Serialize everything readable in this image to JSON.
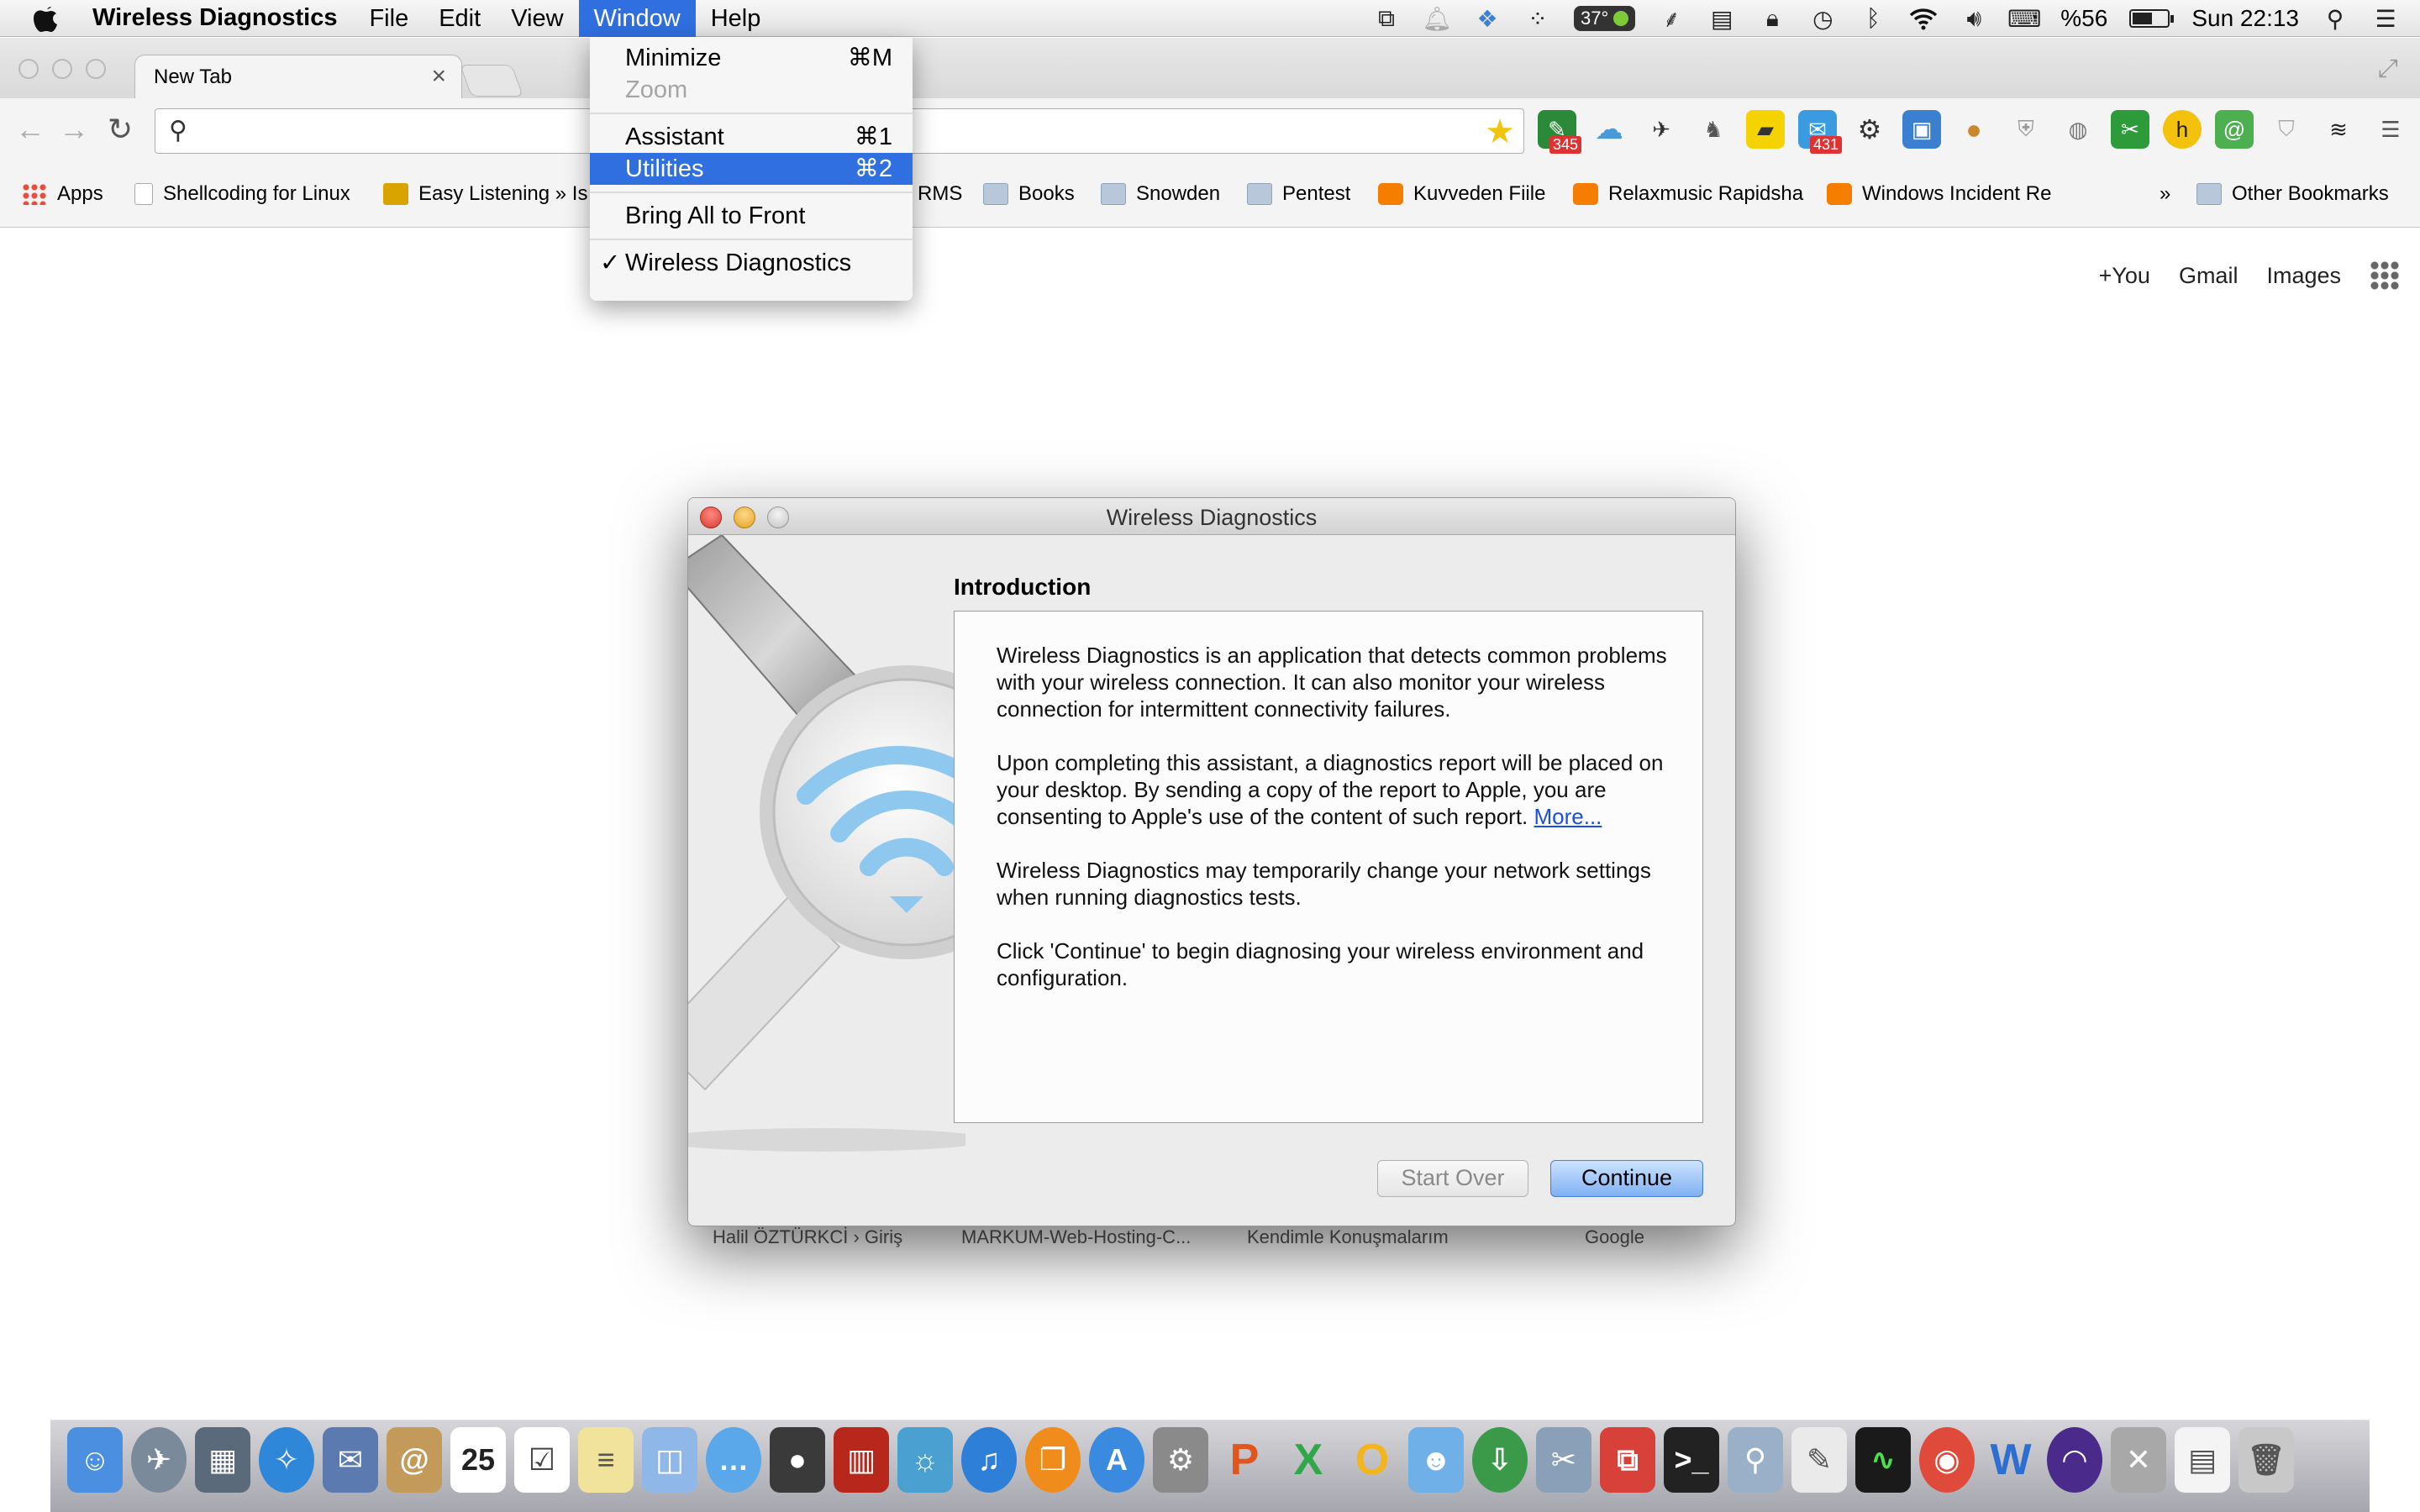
{
  "menubar": {
    "app_name": "Wireless Diagnostics",
    "menus": [
      "File",
      "Edit",
      "View",
      "Window",
      "Help"
    ],
    "status": {
      "temperature": "37°",
      "battery_percent": "%56",
      "battery_level": 0.56,
      "clock": "Sun 22:13"
    }
  },
  "window_menu": {
    "items": [
      {
        "label": "Minimize",
        "shortcut": "⌘M"
      },
      {
        "label": "Zoom",
        "shortcut": ""
      },
      {
        "label": "Assistant",
        "shortcut": "⌘1"
      },
      {
        "label": "Utilities",
        "shortcut": "⌘2"
      },
      {
        "label": "Bring All to Front",
        "shortcut": ""
      },
      {
        "label": "Wireless Diagnostics",
        "shortcut": "",
        "check": "✓"
      }
    ]
  },
  "browser": {
    "tab_title": "New Tab",
    "tab_close": "×",
    "omnibox_value": "",
    "badges": {
      "ext_345": "345",
      "ext_431": "431"
    },
    "bookmarks": [
      "Apps",
      "Shellcoding for Linux",
      "Easy Listening » Is",
      "RMS",
      "Books",
      "Snowden",
      "Pentest",
      "Kuvveden Fiile",
      "Relaxmusic Rapidsha",
      "Windows Incident Re",
      "»",
      "Other Bookmarks"
    ],
    "google_links": {
      "you": "+You",
      "gmail": "Gmail",
      "images": "Images"
    },
    "tiles": [
      "Halil ÖZTÜRKCİ › Giriş",
      "MARKUM-Web-Hosting-C...",
      "Kendimle Konuşmalarım",
      "Google"
    ]
  },
  "dialog": {
    "title": "Wireless Diagnostics",
    "heading": "Introduction",
    "paragraphs": [
      "Wireless Diagnostics is an application that detects common problems with your wireless connection. It can also monitor your wireless connection for intermittent connectivity failures.",
      "Upon completing this assistant, a diagnostics report will be placed on your desktop. By sending a copy of the report to Apple, you are consenting to Apple's use of the content of such report.",
      "Wireless Diagnostics may temporarily change your network settings when running diagnostics tests.",
      "Click 'Continue' to begin diagnosing your wireless environment and configuration."
    ],
    "more_link": "More...",
    "start_over": "Start Over",
    "continue": "Continue"
  },
  "colors": {
    "menu_highlight": "#2f6fe0",
    "continue_button": "#7fb0f2",
    "link": "#1a4fe0"
  },
  "icons": {
    "menubar": [
      "apple-icon"
    ],
    "status": [
      "window-switch-icon",
      "notification-bell-icon",
      "dropbox-icon",
      "app-grid-icon",
      "temperature-icon",
      "microphone-icon",
      "battery-app-icon",
      "lock-icon",
      "time-machine-icon",
      "bluetooth-icon",
      "wifi-icon",
      "volume-icon",
      "keyboard-icon",
      "battery-icon",
      "spotlight-icon",
      "notification-list-icon"
    ],
    "dock": [
      "finder-icon",
      "launchpad-icon",
      "mission-control-icon",
      "safari-icon",
      "mail-bird-icon",
      "contacts-icon",
      "calendar-icon",
      "reminders-icon",
      "notes-icon",
      "preview-icon",
      "messages-icon",
      "facetime-icon",
      "photo-booth-icon",
      "iphoto-icon",
      "itunes-icon",
      "ibooks-icon",
      "app-store-icon",
      "system-preferences-icon",
      "powerpoint-icon",
      "excel-icon",
      "outlook-icon",
      "messenger-icon",
      "network-icon",
      "archive-icon",
      "vm-icon",
      "terminal-icon",
      "preview-photos-icon",
      "text-editor-icon",
      "activity-monitor-icon",
      "chrome-icon",
      "word-icon",
      "wireless-diagnostics-icon",
      "utilities-icon",
      "documents-icon",
      "trash-icon"
    ]
  }
}
